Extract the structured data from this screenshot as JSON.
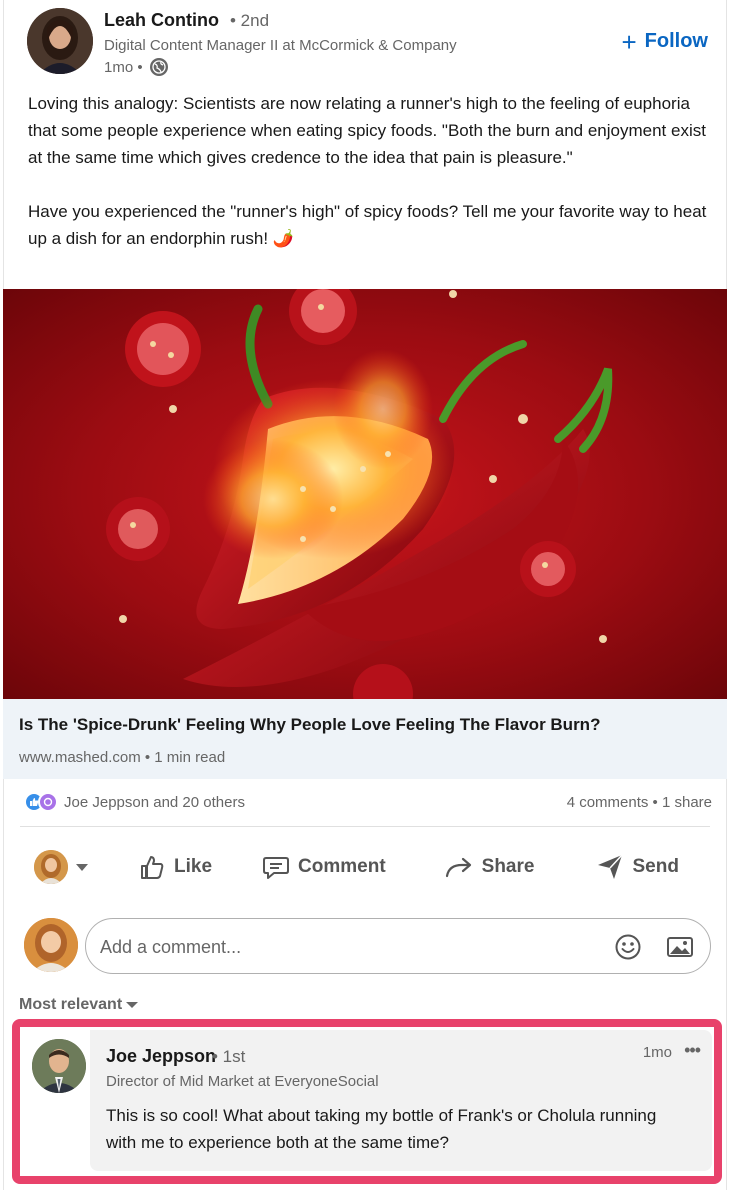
{
  "post": {
    "author": {
      "name": "Leah Contino",
      "degree": "• 2nd",
      "headline": "Digital Content Manager II at McCormick & Company",
      "time": "1mo •"
    },
    "follow_label": "Follow",
    "text": {
      "paragraph_1": "Loving this analogy: Scientists are now relating a runner's high to the feeling of euphoria that some people experience when eating spicy foods. \"Both the burn and enjoyment exist at the same time which gives credence to the idea that pain is pleasure.\"",
      "paragraph_2": "Have you experienced the \"runner's high\" of spicy foods? Tell me your favorite way to heat up a dish for an endorphin rush! 🌶️"
    },
    "link": {
      "title": "Is The 'Spice-Drunk' Feeling Why People Love Feeling The Flavor Burn?",
      "source": "www.mashed.com • 1 min read"
    }
  },
  "social": {
    "reactions_text": "Joe Jeppson and 20 others",
    "counts_text": "4 comments • 1 share",
    "reaction_icons": [
      "like-icon",
      "curious-icon"
    ]
  },
  "actions": {
    "like": "Like",
    "comment": "Comment",
    "share": "Share",
    "send": "Send"
  },
  "comment_box": {
    "placeholder": "Add a comment..."
  },
  "sort_label": "Most relevant",
  "highlighted_comment": {
    "name": "Joe Jeppson",
    "degree": "• 1st",
    "headline": "Director of Mid Market at EveryoneSocial",
    "time": "1mo",
    "text": "This is so cool! What about taking my bottle of Frank's or Cholula running with me to experience both at the same time?"
  },
  "colors": {
    "brand_blue": "#0a66c2",
    "highlight_border": "#e8426b",
    "link_box_bg": "#eef3f8"
  }
}
